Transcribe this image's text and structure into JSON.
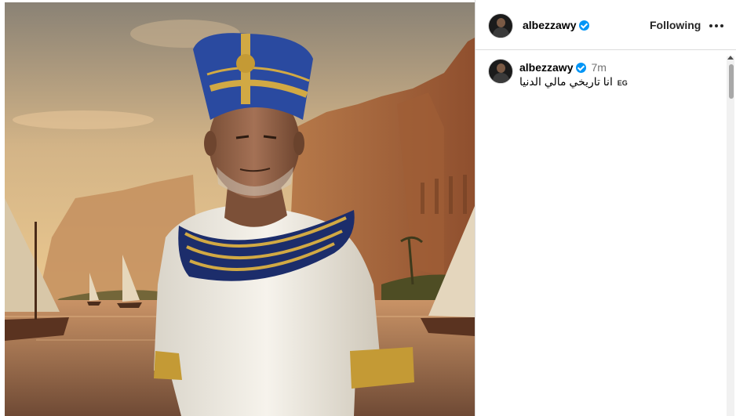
{
  "post": {
    "image_alt": "Portrait of a man dressed as an Egyptian pharaoh beside the Nile with sailboats and cliffs"
  },
  "header": {
    "username": "albezzawy",
    "verified": true,
    "follow_label": "Following",
    "more_icon": "more-horizontal-icon"
  },
  "caption": {
    "username": "albezzawy",
    "verified": true,
    "timestamp": "7m",
    "text": "انا تاريخي مالي الدنيا",
    "flag": "EG"
  },
  "colors": {
    "verified_blue": "#0095f6",
    "divider": "#dbdbdb",
    "muted_text": "#737373"
  }
}
